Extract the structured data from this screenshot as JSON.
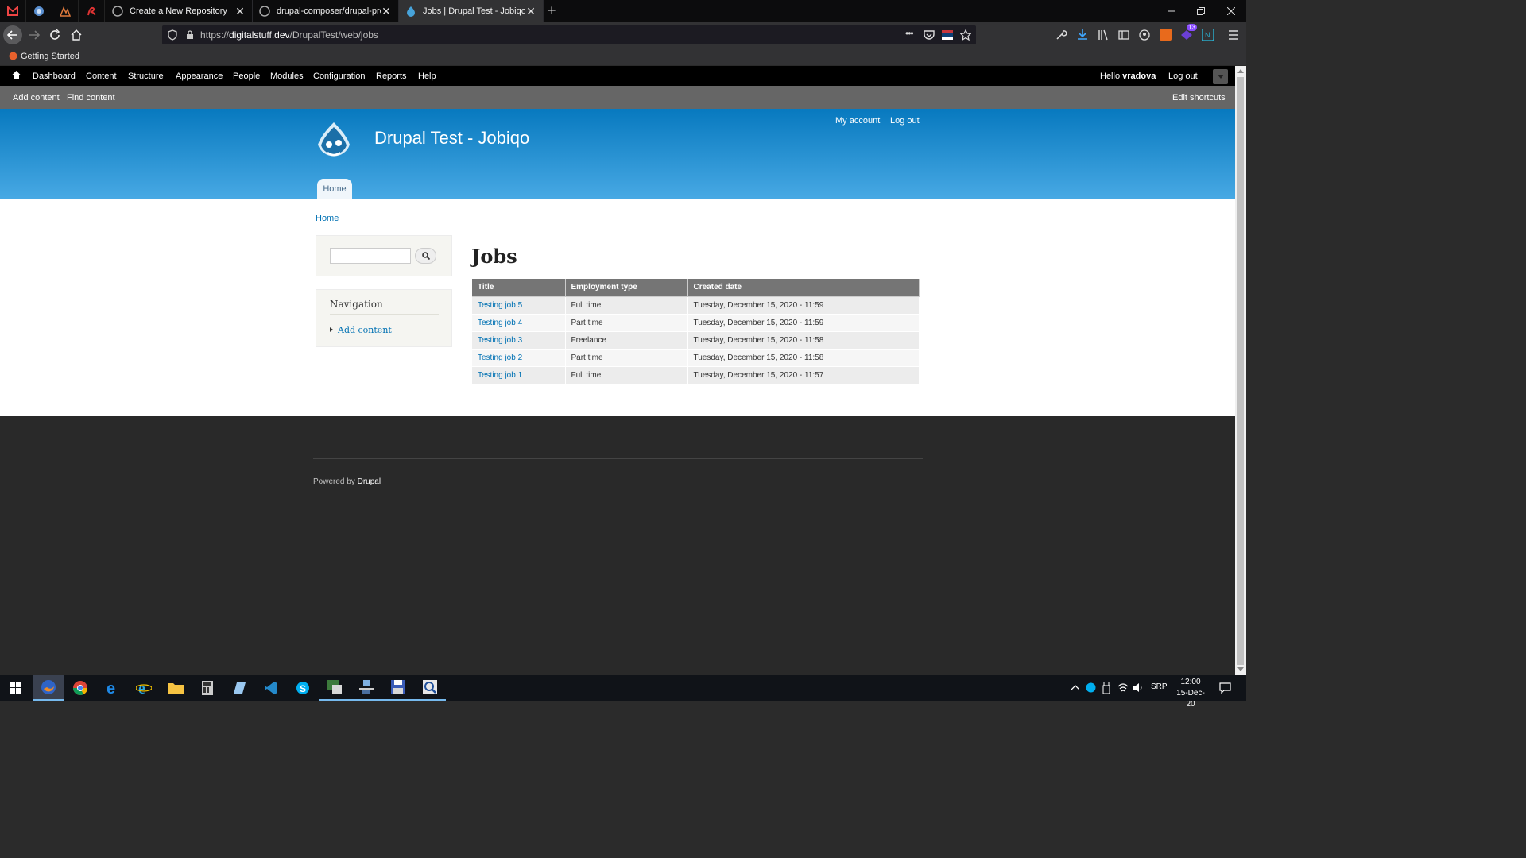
{
  "browser": {
    "tabs": [
      {
        "title": "Create a New Repository",
        "close": "✕"
      },
      {
        "title": "drupal-composer/drupal-proje",
        "close": "✕"
      },
      {
        "title": "Jobs | Drupal Test - Jobiqo",
        "close": "✕"
      }
    ],
    "new_tab": "+",
    "url_prefix": "https://",
    "url_host": "digitalstuff.dev",
    "url_path": "/DrupalTest/web/jobs",
    "url_more": "•••",
    "bookmark": "Getting Started",
    "extension_badge": "13"
  },
  "toolbar": {
    "items": [
      "Dashboard",
      "Content",
      "Structure",
      "Appearance",
      "People",
      "Modules",
      "Configuration",
      "Reports",
      "Help"
    ],
    "hello": "Hello",
    "user": "vradova",
    "logout": "Log out"
  },
  "shortcuts": {
    "add_content": "Add content",
    "find_content": "Find content",
    "edit_shortcuts": "Edit shortcuts"
  },
  "header": {
    "site_name": "Drupal Test - Jobiqo",
    "my_account": "My account",
    "logout": "Log out",
    "home_tab": "Home"
  },
  "breadcrumb": "Home",
  "sidebar": {
    "navigation_title": "Navigation",
    "add_content": "Add content"
  },
  "page_title": "Jobs",
  "table": {
    "headers": [
      "Title",
      "Employment type",
      "Created date"
    ],
    "rows": [
      {
        "title": "Testing job 5",
        "type": "Full time",
        "date": "Tuesday, December 15, 2020 - 11:59"
      },
      {
        "title": "Testing job 4",
        "type": "Part time",
        "date": "Tuesday, December 15, 2020 - 11:59"
      },
      {
        "title": "Testing job 3",
        "type": "Freelance",
        "date": "Tuesday, December 15, 2020 - 11:58"
      },
      {
        "title": "Testing job 2",
        "type": "Part time",
        "date": "Tuesday, December 15, 2020 - 11:58"
      },
      {
        "title": "Testing job 1",
        "type": "Full time",
        "date": "Tuesday, December 15, 2020 - 11:57"
      }
    ]
  },
  "footer": {
    "powered_by": "Powered by",
    "drupal": "Drupal"
  },
  "taskbar": {
    "lang": "SRP",
    "time": "12:00",
    "date": "15-Dec-20"
  },
  "colors": {
    "header_top": "#0779bf",
    "header_bottom": "#48a9e4",
    "link": "#0071b3",
    "footer_bg": "#292929"
  }
}
